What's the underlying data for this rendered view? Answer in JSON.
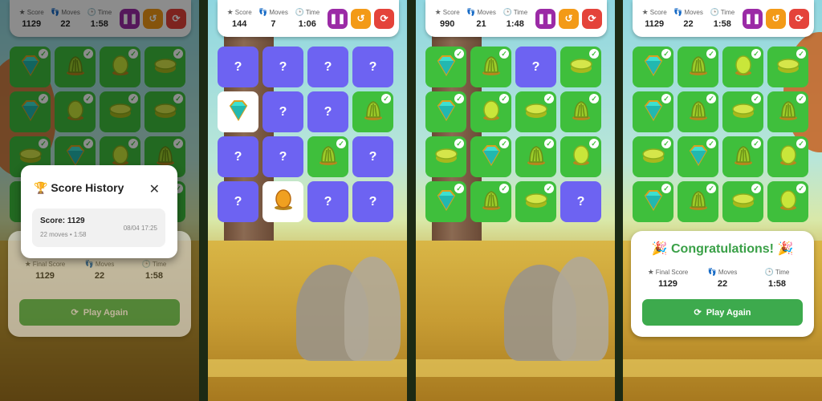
{
  "labels": {
    "score": "Score",
    "moves": "Moves",
    "time": "Time",
    "final_score": "Final Score",
    "play_again": "Play Again",
    "congrats": "Congratulations!"
  },
  "icons": {
    "pause": "pause-icon",
    "history": "history-icon",
    "reset": "reset-icon",
    "trophy": "trophy-icon",
    "close": "close-icon"
  },
  "panels": [
    {
      "score": "1129",
      "moves": "22",
      "time": "1:58"
    },
    {
      "score": "144",
      "moves": "7",
      "time": "1:06"
    },
    {
      "score": "990",
      "moves": "21",
      "time": "1:48"
    },
    {
      "score": "1129",
      "moves": "22",
      "time": "1:58"
    }
  ],
  "result": {
    "score": "1129",
    "moves": "22",
    "time": "1:58"
  },
  "history": {
    "title": "Score History",
    "entry_score": "Score: 1129",
    "entry_meta": "22 moves • 1:58",
    "entry_date": "08/04 17:25"
  },
  "boards": [
    [
      "gem",
      "bush",
      "egg",
      "disk",
      "gem",
      "egg",
      "disk",
      "disk",
      "disk",
      "gem",
      "egg",
      "bush",
      "gem",
      "egg",
      "bush",
      "bush"
    ],
    [
      "?",
      "?",
      "?",
      "?",
      "gem",
      "?",
      "?",
      "bush",
      "?",
      "?",
      "bush",
      "?",
      "?",
      "bush",
      "?",
      "?"
    ],
    [
      "gem",
      "bush",
      "?",
      "disk",
      "gem",
      "egg",
      "disk",
      "bush",
      "disk",
      "gem",
      "bush",
      "egg",
      "gem",
      "bush",
      "disk",
      "?"
    ],
    [
      "gem",
      "bush",
      "egg",
      "disk",
      "gem",
      "bush",
      "disk",
      "bush",
      "disk",
      "gem",
      "bush",
      "egg",
      "gem",
      "bush",
      "disk",
      "egg"
    ]
  ],
  "board_states": [
    [
      "m",
      "m",
      "m",
      "m",
      "m",
      "m",
      "m",
      "m",
      "m",
      "m",
      "m",
      "m",
      "m",
      "m",
      "m",
      "m"
    ],
    [
      "h",
      "h",
      "h",
      "h",
      "f",
      "h",
      "h",
      "m",
      "h",
      "h",
      "m",
      "h",
      "h",
      "f",
      "h",
      "h"
    ],
    [
      "m",
      "m",
      "h",
      "m",
      "m",
      "m",
      "m",
      "m",
      "m",
      "m",
      "m",
      "m",
      "m",
      "m",
      "m",
      "h"
    ],
    [
      "m",
      "m",
      "m",
      "m",
      "m",
      "m",
      "m",
      "m",
      "m",
      "m",
      "m",
      "m",
      "m",
      "m",
      "m",
      "m"
    ]
  ]
}
